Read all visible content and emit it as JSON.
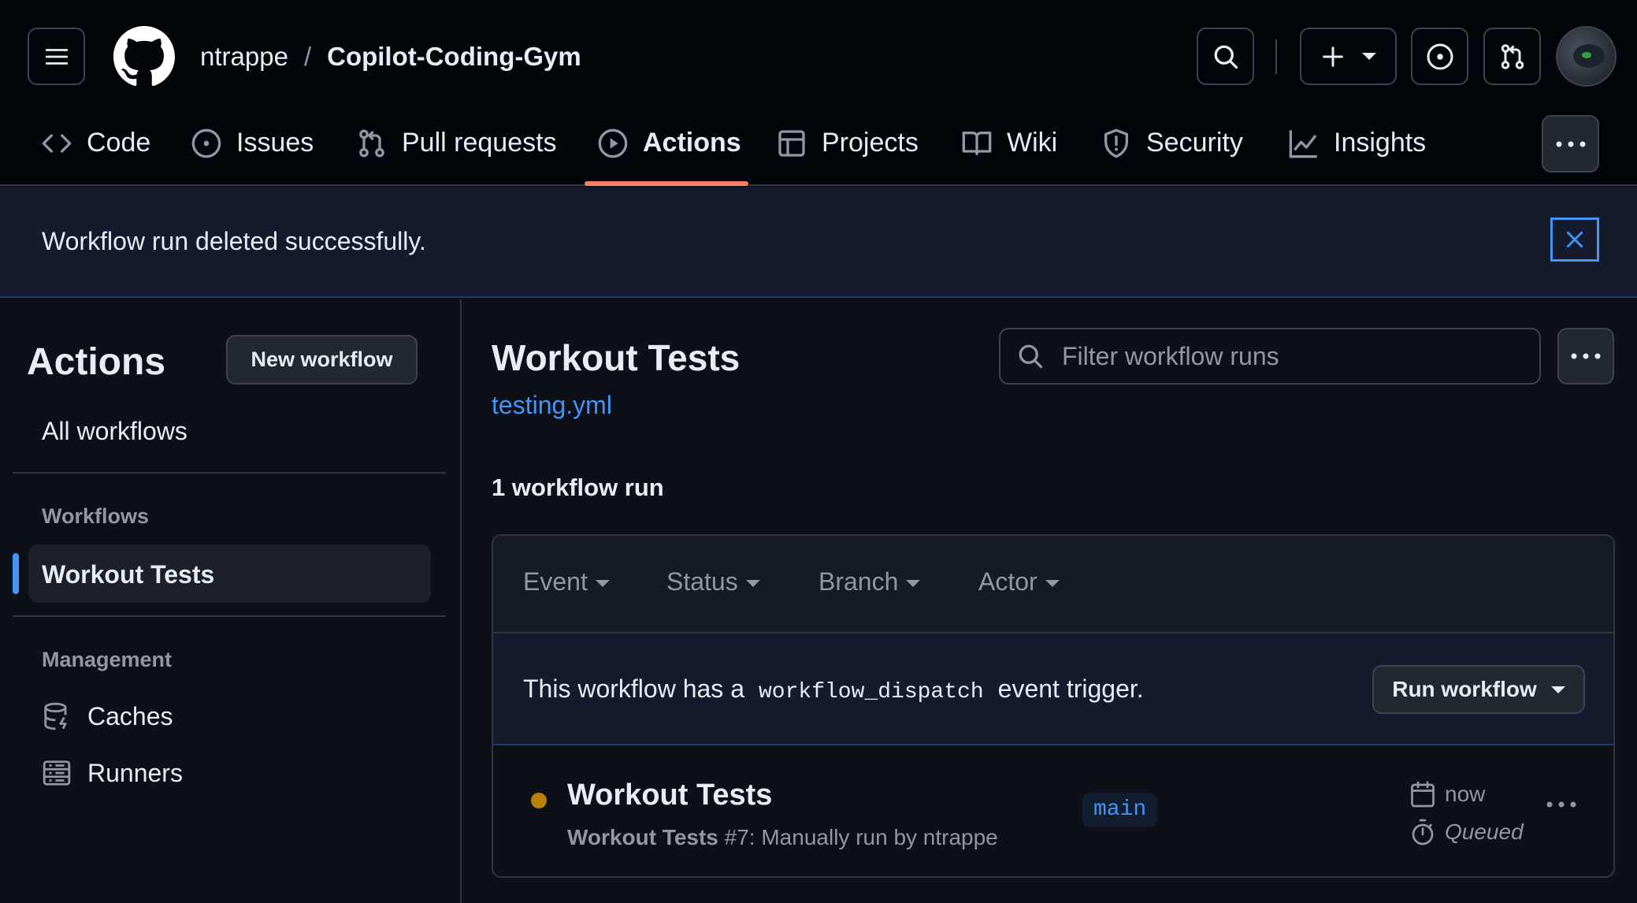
{
  "repo": {
    "owner": "ntrappe",
    "separator": "/",
    "name": "Copilot-Coding-Gym"
  },
  "tabs": [
    {
      "label": "Code",
      "icon": "code-icon"
    },
    {
      "label": "Issues",
      "icon": "issue-opened-icon"
    },
    {
      "label": "Pull requests",
      "icon": "git-pull-request-icon"
    },
    {
      "label": "Actions",
      "icon": "play-icon",
      "active": true
    },
    {
      "label": "Projects",
      "icon": "table-icon"
    },
    {
      "label": "Wiki",
      "icon": "book-icon"
    },
    {
      "label": "Security",
      "icon": "shield-icon"
    },
    {
      "label": "Insights",
      "icon": "graph-icon"
    }
  ],
  "flash": {
    "message": "Workflow run deleted successfully."
  },
  "sidebar": {
    "title": "Actions",
    "new_workflow_label": "New workflow",
    "all_workflows_label": "All workflows",
    "workflows_heading": "Workflows",
    "workflows": [
      {
        "label": "Workout Tests",
        "active": true
      }
    ],
    "management_heading": "Management",
    "management_items": [
      {
        "label": "Caches",
        "icon": "database-icon"
      },
      {
        "label": "Runners",
        "icon": "server-icon"
      }
    ]
  },
  "main": {
    "title": "Workout Tests",
    "file_link": "testing.yml",
    "filter_placeholder": "Filter workflow runs",
    "run_count": "1 workflow run",
    "filters": [
      "Event",
      "Status",
      "Branch",
      "Actor"
    ],
    "dispatch": {
      "prefix": "This workflow has a",
      "code": "workflow_dispatch",
      "suffix": "event trigger.",
      "button_label": "Run workflow"
    },
    "runs": [
      {
        "title": "Workout Tests",
        "workflow_name": "Workout Tests",
        "detail": "#7: Manually run by ntrappe",
        "branch": "main",
        "time": "now",
        "status": "Queued",
        "status_color": "#bb8009"
      }
    ]
  },
  "colors": {
    "accent": "#4493f8",
    "tab_underline": "#f78166",
    "background": "#0d1117",
    "header": "#010409"
  }
}
